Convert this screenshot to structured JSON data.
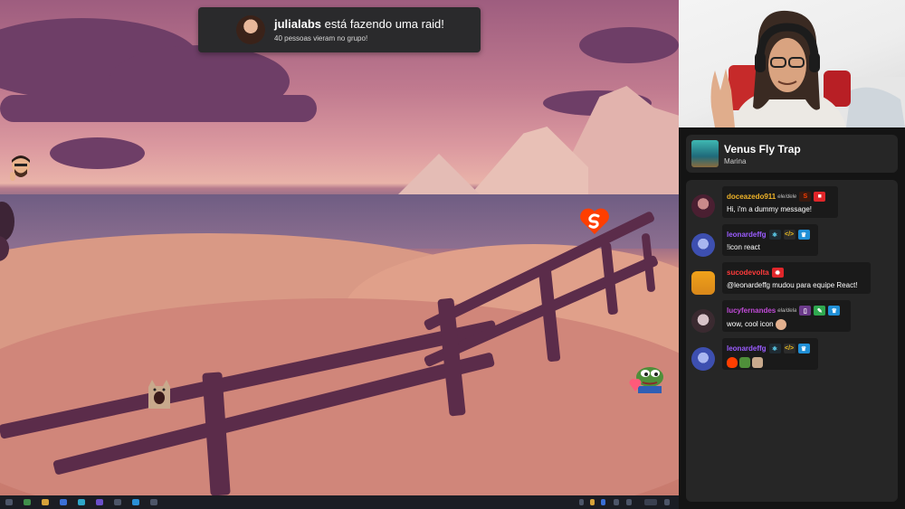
{
  "raid": {
    "raider": "julialabs",
    "title_suffix": "está fazendo uma raid!",
    "subtitle": "40 pessoas vieram no grupo!"
  },
  "now_playing": {
    "song": "Venus Fly Trap",
    "artist": "Marina"
  },
  "chat": {
    "messages": [
      {
        "user": "doceazedo911",
        "pronoun": "ele/dele",
        "user_color": "#f0b429",
        "badges": [
          "svelte-icon",
          "camera-icon"
        ],
        "text": "Hi, i'm a dummy message!",
        "avatar_color": "#7a3a52"
      },
      {
        "user": "leonardeffg",
        "pronoun": "",
        "user_color": "#9b5cff",
        "badges": [
          "react-icon",
          "code-icon",
          "crown-icon"
        ],
        "text": "!icon react",
        "avatar_color": "#4b5fb7"
      },
      {
        "user": "sucodevolta",
        "pronoun": "",
        "user_color": "#ff3b3b",
        "badges": [
          "gear-icon"
        ],
        "text": "@leonardeffg mudou para equipe React!",
        "avatar_color": "#f0a21a"
      },
      {
        "user": "lucyfernandes",
        "pronoun": "ela/dela",
        "user_color": "#c14bd8",
        "badges": [
          "book-icon",
          "pencil-icon",
          "crown-icon"
        ],
        "text": "wow, cool icon",
        "avatar_color": "#d4d0d6"
      },
      {
        "user": "leonardeffg",
        "pronoun": "",
        "user_color": "#9b5cff",
        "badges": [
          "react-icon",
          "code-icon",
          "crown-icon"
        ],
        "text": "",
        "avatar_color": "#4b5fb7"
      }
    ]
  },
  "colors": {
    "accent_svelte": "#ff3e00",
    "panel_bg": "#262626"
  }
}
